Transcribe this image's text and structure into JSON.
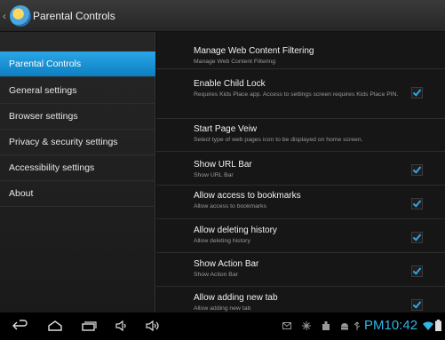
{
  "actionbar": {
    "title": "Parental Controls"
  },
  "sidebar": {
    "items": [
      {
        "label": "Parental Controls",
        "active": true
      },
      {
        "label": "General settings",
        "active": false
      },
      {
        "label": "Browser settings",
        "active": false
      },
      {
        "label": "Privacy & security settings",
        "active": false
      },
      {
        "label": "Accessibility settings",
        "active": false
      },
      {
        "label": "About",
        "active": false
      }
    ]
  },
  "content": {
    "rows": [
      {
        "title": "Manage Web Content Filtering",
        "summary": "Manage Web Content Filtering",
        "checked": null
      },
      {
        "title": "Enable Child Lock",
        "summary": "Requires Kids Place app. Access to settings screen requires Kids Place PIN.",
        "checked": true
      },
      {
        "title": "Start Page Veiw",
        "summary": "Select type of web pages icon to be displayed on home screen.",
        "checked": null
      },
      {
        "title": "Show URL Bar",
        "summary": "Show URL Bar",
        "checked": true
      },
      {
        "title": "Allow access to bookmarks",
        "summary": "Allow access to bookmarks",
        "checked": true
      },
      {
        "title": "Allow deleting history",
        "summary": "Allow deleting history",
        "checked": true
      },
      {
        "title": "Show Action Bar",
        "summary": "Show Action Bar",
        "checked": true
      },
      {
        "title": "Allow adding new tab",
        "summary": "Allow adding new tab",
        "checked": true
      }
    ]
  },
  "sysbar": {
    "clock": "PM10:42",
    "icons": [
      "back-icon",
      "home-icon",
      "recent-apps-icon",
      "volume-down-icon",
      "volume-up-icon",
      "gmail-icon",
      "usb-debug-icon",
      "download-icon",
      "android-icon",
      "usb-icon",
      "wifi-icon",
      "battery-icon"
    ]
  },
  "colors": {
    "accent": "#33b5e5",
    "selected": "#1591d4"
  }
}
